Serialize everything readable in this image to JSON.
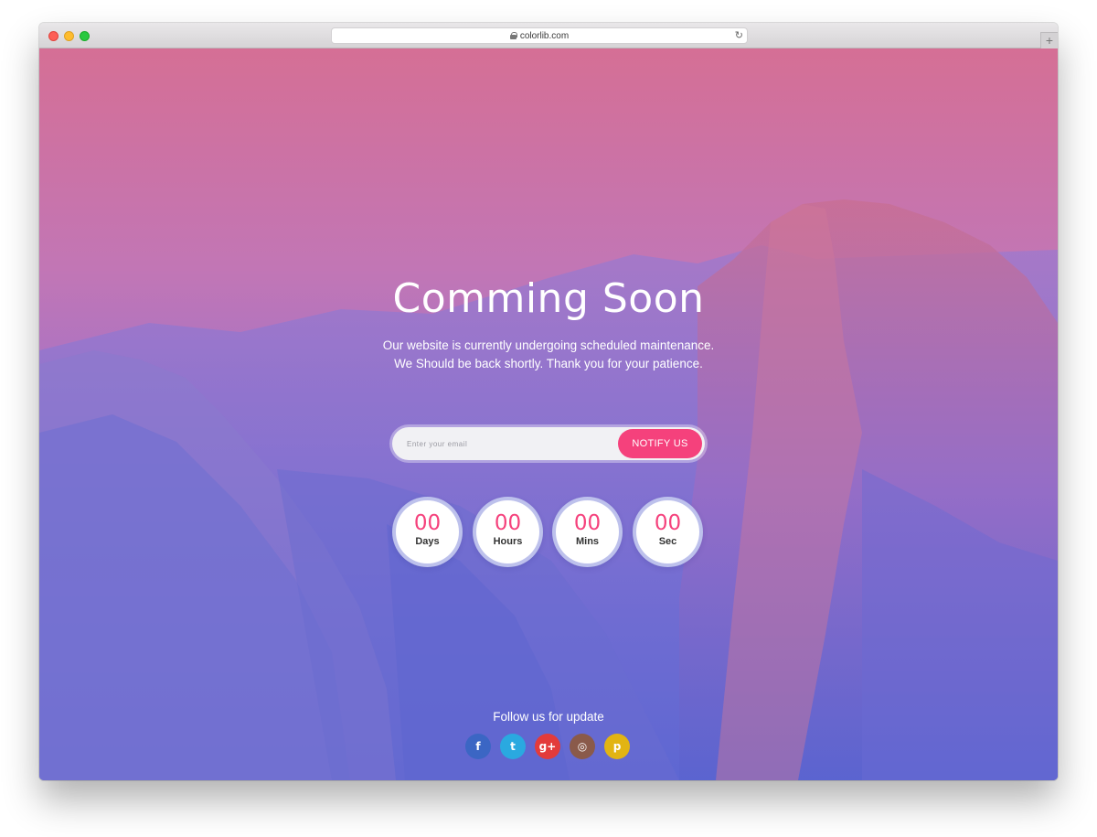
{
  "browser": {
    "url": "colorlib.com",
    "new_tab_label": "+"
  },
  "hero": {
    "title": "Comming Soon",
    "subtitle_line1": "Our website is currently undergoing scheduled maintenance.",
    "subtitle_line2": "We Should be back shortly. Thank you for your patience."
  },
  "notify_form": {
    "email_placeholder": "Enter your email",
    "button_label": "NOTIFY US"
  },
  "countdown": [
    {
      "value": "00",
      "label": "Days"
    },
    {
      "value": "00",
      "label": "Hours"
    },
    {
      "value": "00",
      "label": "Mins"
    },
    {
      "value": "00",
      "label": "Sec"
    }
  ],
  "footer": {
    "follow_label": "Follow us for update",
    "social": [
      {
        "icon": "facebook-icon",
        "glyph": "f",
        "color": "#3b66c4"
      },
      {
        "icon": "twitter-icon",
        "glyph": "t",
        "color": "#2aa9e0"
      },
      {
        "icon": "google-plus-icon",
        "glyph": "g+",
        "color": "#e33b3b"
      },
      {
        "icon": "instagram-icon",
        "glyph": "◎",
        "color": "#8a5a4a"
      },
      {
        "icon": "pinterest-icon",
        "glyph": "p",
        "color": "#e2b413"
      }
    ]
  },
  "colors": {
    "accent": "#f5417c",
    "gradient_top": "#d56f95",
    "gradient_bottom": "#5a65d5"
  }
}
